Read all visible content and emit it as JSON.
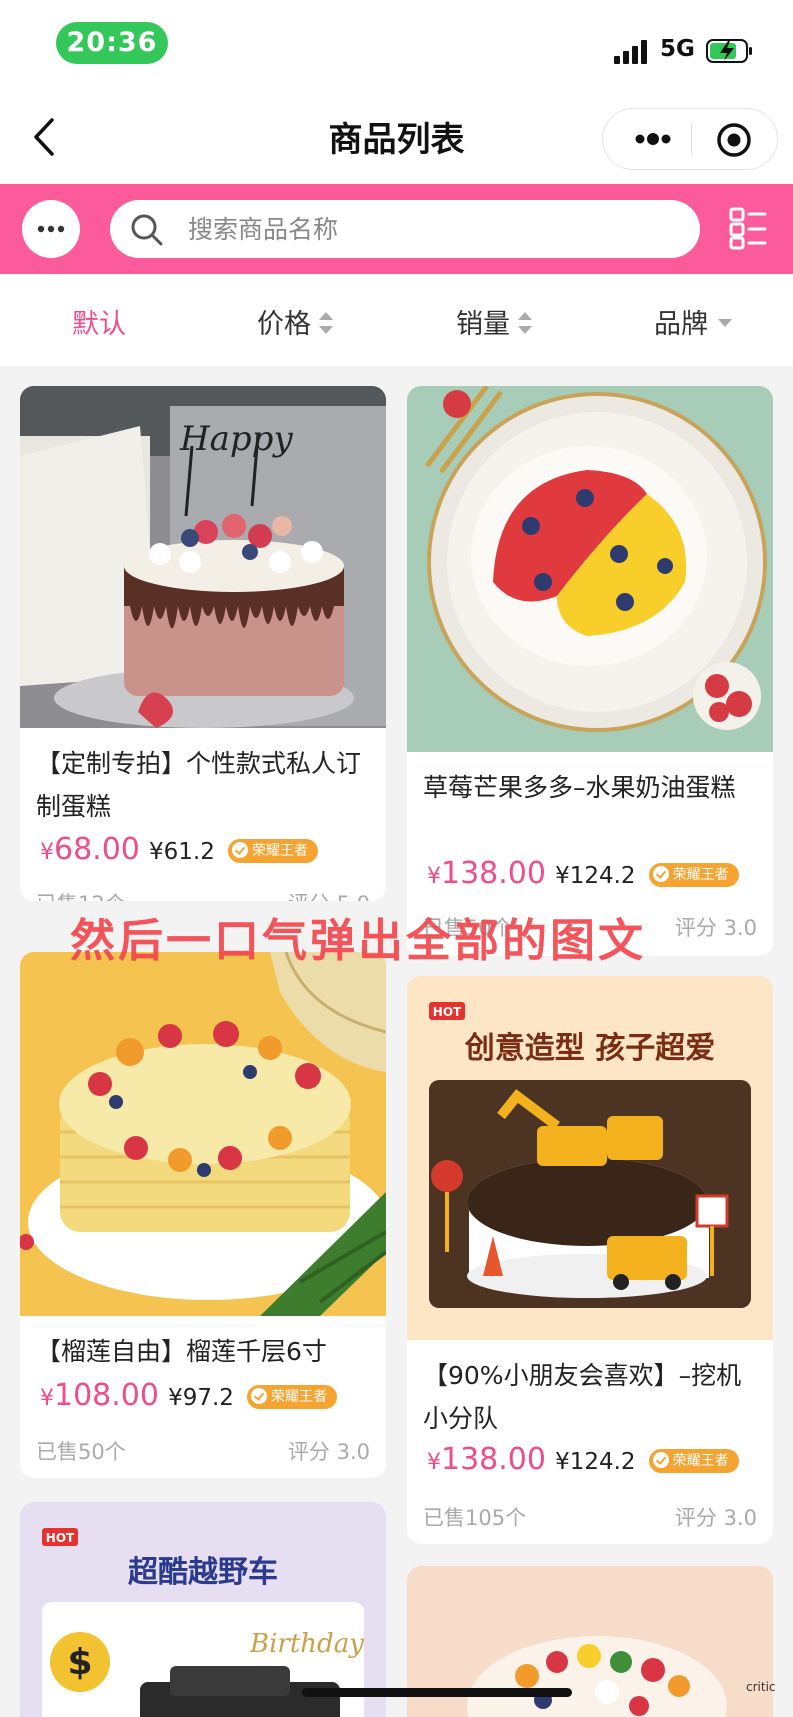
{
  "status_bar": {
    "time": "20:36",
    "network": "5G"
  },
  "nav": {
    "title": "商品列表"
  },
  "search": {
    "placeholder": "搜索商品名称"
  },
  "filters": [
    {
      "label": "默认",
      "active": true
    },
    {
      "label": "价格",
      "indicator": "sort-arrows"
    },
    {
      "label": "销量",
      "indicator": "sort-arrows"
    },
    {
      "label": "品牌",
      "indicator": "dropdown"
    }
  ],
  "products": [
    {
      "title": "【定制专拍】个性款式私人订制蛋糕",
      "currency": "¥",
      "price": "68.00",
      "member_price": "¥61.2",
      "badge": "荣耀王者",
      "sold": "已售12个",
      "rating": "评分 5.0"
    },
    {
      "title": "草莓芒果多多–水果奶油蛋糕",
      "currency": "¥",
      "price": "138.00",
      "member_price": "¥124.2",
      "badge": "荣耀王者",
      "sold": "已售50个",
      "rating": "评分 3.0"
    },
    {
      "title": "【榴莲自由】榴莲千层6寸",
      "currency": "¥",
      "price": "108.00",
      "member_price": "¥97.2",
      "badge": "荣耀王者",
      "sold": "已售50个",
      "rating": "评分 3.0"
    },
    {
      "title": "【90%小朋友会喜欢】–挖机小分队",
      "currency": "¥",
      "price": "138.00",
      "member_price": "¥124.2",
      "badge": "荣耀王者",
      "sold": "已售105个",
      "rating": "评分 3.0",
      "image_tag": "HOT",
      "image_headline": "创意造型 孩子超爱"
    },
    {
      "image_tag": "HOT",
      "image_headline": "超酷越野车"
    },
    {}
  ],
  "overlay_caption": "然后一口气弹出全部的图文",
  "watermark": "critic",
  "colors": {
    "brand_pink": "#fb5b9a",
    "price_pink": "#f04c8c",
    "badge_orange": "#f6a431",
    "caption_red": "#f2474d",
    "time_green": "#34c759"
  }
}
